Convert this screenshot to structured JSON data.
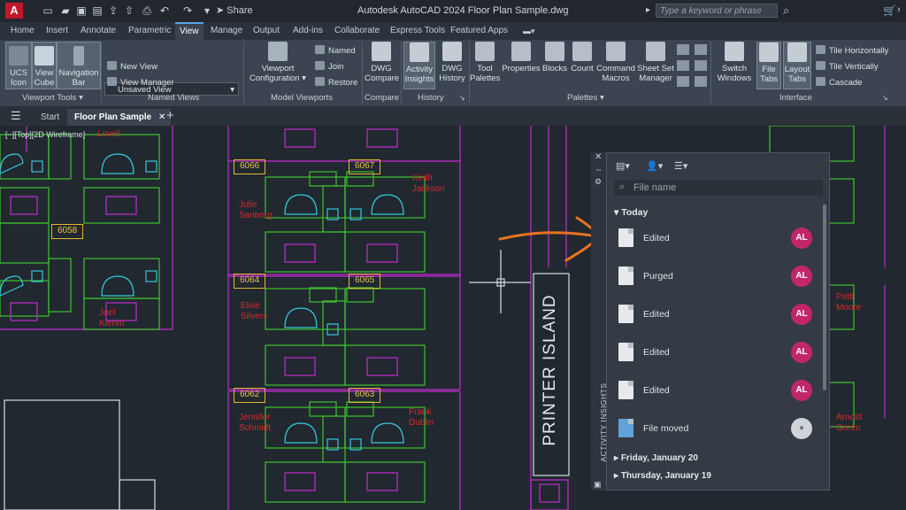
{
  "app": {
    "title": "Autodesk AutoCAD 2024   Floor Plan Sample.dwg",
    "logo": "A",
    "share_label": "Share",
    "search_placeholder": "Type a keyword or phrase"
  },
  "ribbon_tabs": [
    "Home",
    "Insert",
    "Annotate",
    "Parametric",
    "View",
    "Manage",
    "Output",
    "Add-ins",
    "Collaborate",
    "Express Tools",
    "Featured Apps"
  ],
  "active_tab": "View",
  "ribbon": {
    "viewport_tools": {
      "title": "Viewport Tools",
      "ucs_icon": "UCS Icon",
      "view_cube": "View Cube",
      "navigation_bar": "Navigation Bar"
    },
    "named_views": {
      "title": "Named Views",
      "dropdown_value": "Unsaved View",
      "new_view": "New View",
      "view_manager": "View Manager"
    },
    "model_viewports": {
      "title": "Model Viewports",
      "viewport_configuration": "Viewport Configuration",
      "named": "Named",
      "join": "Join",
      "restore": "Restore"
    },
    "compare": {
      "title": "Compare",
      "dwg_compare": "DWG Compare"
    },
    "history": {
      "title": "History",
      "activity_insights": "Activity Insights",
      "dwg_history": "DWG History"
    },
    "palettes": {
      "title": "Palettes",
      "tool_palettes": "Tool Palettes",
      "properties": "Properties",
      "blocks": "Blocks",
      "count": "Count",
      "command_macros": "Command Macros",
      "sheet_set_manager": "Sheet Set Manager"
    },
    "interface": {
      "title": "Interface",
      "switch_windows": "Switch Windows",
      "file_tabs": "File Tabs",
      "layout_tabs": "Layout Tabs",
      "tile_horizontally": "Tile Horizontally",
      "tile_vertically": "Tile Vertically",
      "cascade": "Cascade"
    }
  },
  "doc_tabs": {
    "start": "Start",
    "active": "Floor Plan Sample"
  },
  "viewport_label": "[−][Top][2D Wireframe]",
  "drawing": {
    "rooms": [
      "6066",
      "6067",
      "6058",
      "6064",
      "6065",
      "6062",
      "6063"
    ],
    "people": [
      "Julie\nSanborg",
      "Keith\nJackson",
      "Elise\nSilvers",
      "Joel\nKlenm",
      "Jennifer\nSchmidt",
      "Frank\nDublin",
      "Patti\nMoore",
      "Arnold\nGreen",
      "Lovell"
    ],
    "printer_island": "PRINTER ISLAND"
  },
  "activity_panel": {
    "vertical_title": "ACTIVITY INSIGHTS",
    "filter_placeholder": "File name",
    "sections": {
      "today": "Today",
      "friday": "Friday, January 20",
      "thursday": "Thursday, January 19"
    },
    "items": [
      {
        "label": "Edited",
        "avatar": "AL"
      },
      {
        "label": "Purged",
        "avatar": "AL"
      },
      {
        "label": "Edited",
        "avatar": "AL"
      },
      {
        "label": "Edited",
        "avatar": "AL"
      },
      {
        "label": "Edited",
        "avatar": "AL"
      },
      {
        "label": "File moved",
        "avatar": ""
      }
    ]
  }
}
